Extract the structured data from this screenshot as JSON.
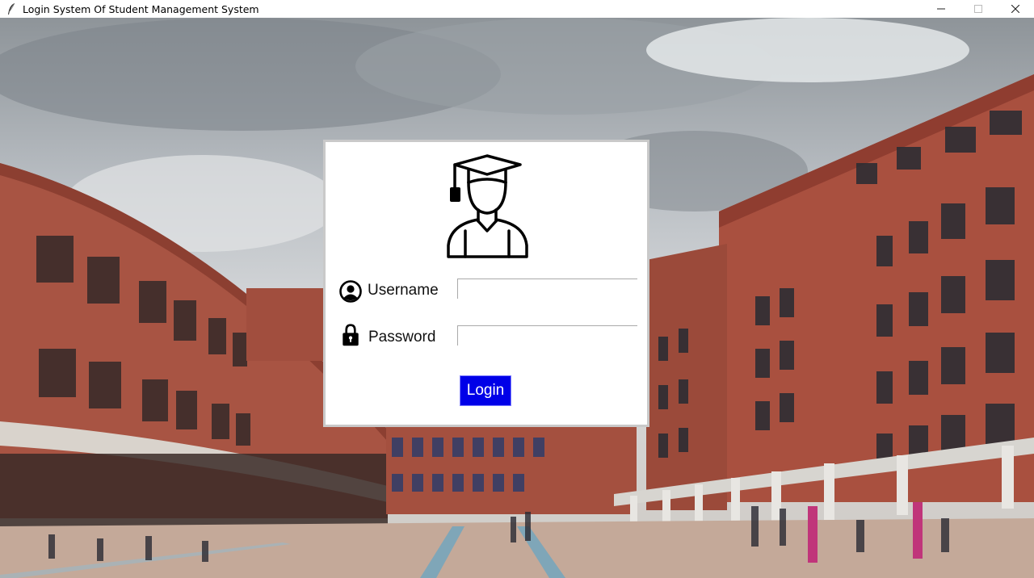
{
  "window": {
    "title": "Login System Of Student Management System",
    "controls": {
      "minimize": "minimize",
      "maximize": "maximize",
      "close": "close"
    }
  },
  "login_form": {
    "username_label": "Username",
    "username_value": "",
    "password_label": "Password",
    "password_value": "",
    "login_button": "Login"
  },
  "colors": {
    "login_button_bg": "#0000e8",
    "card_bg": "#ffffff",
    "brick": "#a8503f"
  },
  "icons": [
    "feather-icon",
    "student-graduate-icon",
    "user-circle-icon",
    "lock-icon"
  ]
}
